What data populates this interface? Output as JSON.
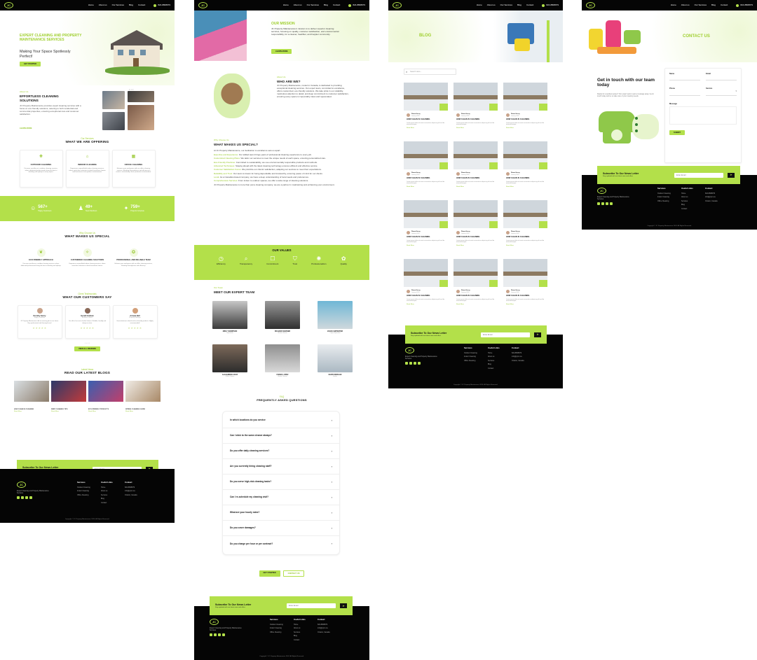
{
  "brand": {
    "accent": "#b3e04a",
    "dark": "#050505",
    "logo_text": "JC"
  },
  "nav": {
    "items": [
      "Home",
      "About us",
      "Our Services",
      "Blog",
      "Contact"
    ],
    "phone": "824-8808979"
  },
  "home": {
    "hero_title": "EXPERT CLEANING AND PROPERTY MAINTENANCE SERVICES",
    "hero_tagline": "Making Your Space Spotlessly Perfect!",
    "hero_button": "GET STARTED",
    "about_sub": "About Us",
    "about_title": "EFFORTLESS CLEANING SOLUTIONS",
    "about_text": "JC Property Maintenance provides expert cleaning services with a focus on eco-friendly solutions, catering to both residential and commercial properties, ensuring exceptional care and customer satisfaction.",
    "about_link": "LEARN MORE",
    "offer_sub": "Our Services",
    "offer_title": "WHAT WE ARE OFFERING",
    "services": [
      {
        "title": "OUTDOOR CLEANING",
        "text": "Discover excellence in outdoor cleaning services, where dedicated professionals bring the best in detailing and upkeep to every space."
      },
      {
        "title": "INDOOR CLEANING",
        "text": "Experience unparalleled indoor cleaning services, where meticulous attention to detail transforms homes and businesses into spotless environments."
      },
      {
        "title": "OFFICE CLEANING",
        "text": "Enhance your workspace with our office cleaning services, blending thoroughness and efficiency to create a consistently clean, productive environment."
      }
    ],
    "stats": [
      {
        "value": "567+",
        "label": "Happy Customers"
      },
      {
        "value": "49+",
        "label": "Team Members"
      },
      {
        "value": "759+",
        "label": "Projects Complete"
      }
    ],
    "special_sub": "Why Choose Us",
    "special_title": "WHAT MAKES US SPECIAL",
    "features": [
      {
        "title": "ECO FRIENDLY APPROACH",
        "text": "Discover excellence in outdoor cleaning services, where dedicated professionals bring the best in detailing and upkeep."
      },
      {
        "title": "CUSTOMIZED CLEANING SOLUTIONS",
        "text": "Experience unparalleled indoor cleaning services, where meticulous attention to detail transforms homes."
      },
      {
        "title": "PROFESSIONAL AND RELIABLE TEAM",
        "text": "Enhance your workspace with our office cleaning services, blending thoroughness and efficiency."
      }
    ],
    "test_sub": "Client Testimonials",
    "test_title": "WHAT OUR CUSTOMERS SAY",
    "testimonials": [
      {
        "name": "Dorothy Henry",
        "role": "Happy Customer",
        "text": "JC Property Maintenance did an amazing job on our home. Very professional and thorough team!"
      },
      {
        "name": "Gerald Graham",
        "role": "Business Owner",
        "text": "Our office has never looked cleaner. Reliable, friendly and always on time."
      },
      {
        "name": "Armani Bell",
        "role": "Property Manager",
        "text": "Great attention to detail and eco-friendly products. Highly recommended!"
      }
    ],
    "test_button": "VIEW ALL REVIEWS",
    "blogs_sub": "Latest News",
    "blogs_title": "READ OUR LATEST BLOGS",
    "blogs": [
      {
        "title": "HOW CLEAN IS CLEANING",
        "link": "Read More"
      },
      {
        "title": "DEEP CLEANING TIPS",
        "link": "Read More"
      },
      {
        "title": "ECO-FRIENDLY PRODUCTS",
        "link": "Read More"
      },
      {
        "title": "SPRING CLEANING GUIDE",
        "link": "Read More"
      }
    ]
  },
  "about": {
    "mission_title": "OUR MISSION",
    "mission_text": "JC Property Maintenance's mission is to deliver superior cleaning services, focusing on quality, customer satisfaction, and environmental responsibility, for a cleaner, healthier, and happier community.",
    "mission_button": "LEARN MORE",
    "who_sub": "About Us",
    "who_title": "WHO ARE WE?",
    "who_text": "JC Property Maintenance, rooted in Canada, is dedicated to providing exceptional cleaning services. Our expert team, committed to excellence, offers customized, eco-friendly solutions. We take pride in our reliability, meticulous attention to detail, and deep commitment to customer satisfaction, ensuring every space is impeccably clean and rejuvenated.",
    "special_sub": "Why Choose Us",
    "special_title": "WHAT MAKES US SPECIAL?",
    "special_intro": "At JC Property Maintenance, our dedication to excellence sets us apart:",
    "special_points": [
      {
        "k": "Expertise and Experience:",
        "v": "Our skilled team brings years of professional cleaning experience to every job."
      },
      {
        "k": "Customized Cleaning Plans:",
        "v": "We tailor our services to meet the unique needs of each space, ensuring personalized care."
      },
      {
        "k": "Eco-Friendly Practices:",
        "v": "Committed to sustainability, we use environmentally responsible products and methods."
      },
      {
        "k": "Advanced Techniques:",
        "v": "Staying ahead with the latest cleaning technology ensures efficient and effective service."
      },
      {
        "k": "Customer Satisfaction Focus:",
        "v": "We prioritize our clients' satisfaction, adapting our services to meet their expectations."
      },
      {
        "k": "Reliability and Trust:",
        "v": "Our team is known for being dependable and trustworthy, ensuring peace of mind for our clients."
      },
      {
        "k": "Local:",
        "v": "As a Canadian-based company, we have a deep understanding of local needs and preferences."
      },
      {
        "k": "Comprehensive Services:",
        "v": "From indoor to outdoor spaces, we offer a wide range of cleaning solutions."
      }
    ],
    "special_outro": "JC Property Maintenance is more than just a cleaning company; we are a partner in maintaining and enhancing your environment.",
    "values_title": "OUR VALUES",
    "values": [
      "Efficiency",
      "Transparency",
      "Commitment",
      "Trust",
      "Professionalism",
      "Quality"
    ],
    "team_sub": "Our Team",
    "team_title": "MEET OUR EXPERT TEAM",
    "team": [
      {
        "name": "MIKE THOMPSON",
        "role": "Supervisor"
      },
      {
        "name": "RICHARD WARNER",
        "role": "Senior Cleaner"
      },
      {
        "name": "JOHN CARPENTER",
        "role": "Carpet Specialist"
      },
      {
        "name": "ALEJANDRO CRUZ",
        "role": "Office Cleaner"
      },
      {
        "name": "FRANK LOPEZ",
        "role": "House Cleaner"
      },
      {
        "name": "DAVID MORGAN",
        "role": "Janitor"
      }
    ],
    "faq_sub": "FAQ",
    "faq_title": "FREQUENTLY ASKED QUESTIONS",
    "faqs": [
      "In which locations do you service",
      "Can I stick to the same cleaner always?",
      "Do you offer daily cleaning services?",
      "Are you currently hiring cleaning staff?",
      "Do you serve high-risk cleaning tasks?",
      "Can I re-schedule my cleaning visit?",
      "What are your hourly rates?",
      "Do you cover damages?",
      "Do you charge per hour or per contract?"
    ],
    "cta_primary": "GET STARTED",
    "cta_secondary": "CONTACT US"
  },
  "blog": {
    "title": "BLOG",
    "search_placeholder": "Search Here...",
    "post_title": "HOW CLEAN IS CLEANING",
    "author": "Diana Henry",
    "date": "January 2024",
    "excerpt": "Lorem ipsum dolor sit amet consectetur adipiscing elit sed do eiusmod tempor.",
    "link": "Read More"
  },
  "contact": {
    "title": "CONTACT US",
    "heading": "Get in touch with our team today",
    "text": "Ready for a spotless space? Our expert team is just a message away. Get in touch today and let us take care of your cleaning needs.",
    "fields": {
      "name": "Name",
      "email": "Email",
      "phone": "Phone",
      "service": "Service",
      "message": "Message"
    },
    "submit": "SUBMIT"
  },
  "footer": {
    "newsletter_title": "Subscribe To Our News Letter",
    "newsletter_text": "Stay updated with our latest news and offers",
    "email_placeholder": "Enter Email",
    "tagline": "Expert Cleaning and Property Maintenance Services",
    "col1_title": "Services",
    "col1": [
      "Outdoor Cleaning",
      "Indoor Cleaning",
      "Office Cleaning"
    ],
    "col2_title": "Useful Links",
    "col2": [
      "Home",
      "About us",
      "Services",
      "Blog",
      "Contact"
    ],
    "col3_title": "Contact",
    "col3": [
      "824-8808979",
      "info@jcpm.ca",
      "Ontario, Canada"
    ],
    "copyright": "Copyright © JC Property Maintenance 2024. All Rights Reserved."
  }
}
